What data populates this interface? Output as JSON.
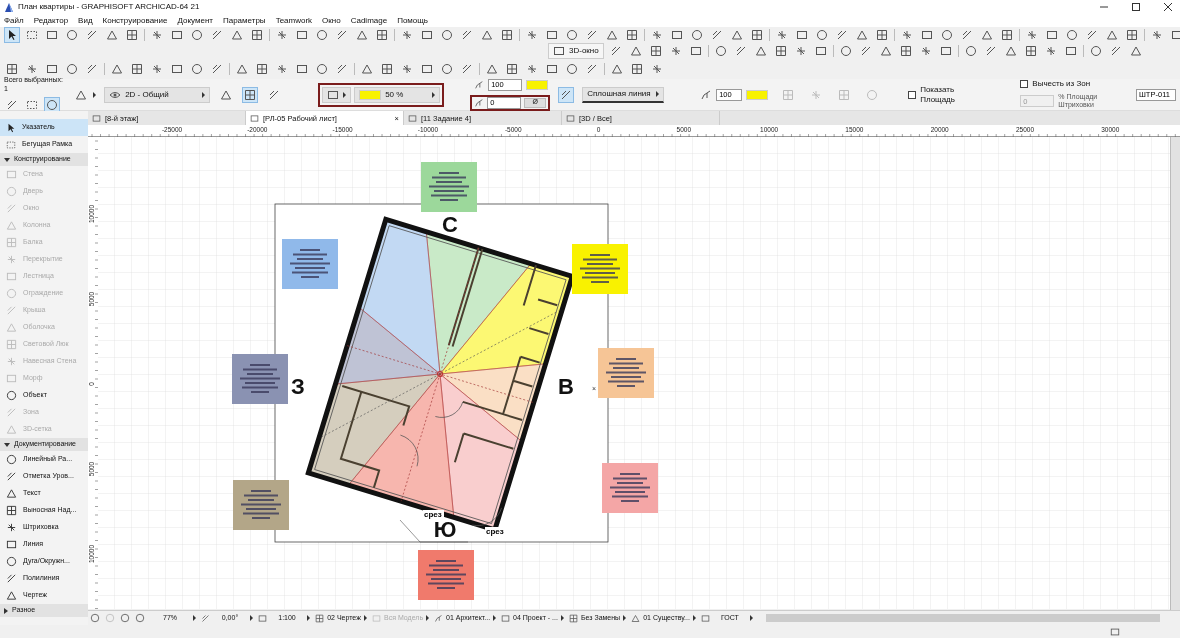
{
  "window": {
    "title": "План квартиры - GRAPHISOFT ARCHICAD-64 21"
  },
  "menu": [
    "Файл",
    "Редактор",
    "Вид",
    "Конструирование",
    "Документ",
    "Параметры",
    "Teamwork",
    "Окно",
    "Cadimage",
    "Помощь"
  ],
  "toolbar": {
    "view_3d_button": "3D-окно"
  },
  "info_box": {
    "selection_count": "Всего выбранных: 1",
    "layer_combo": "2D - Общий",
    "fill_reading": "50 %",
    "pen_weight": "100",
    "background_pen": "0",
    "background_button": "Ø",
    "line_type": "Сплошная линия",
    "fill_pen": "100",
    "show_area": {
      "label": "Показать Площадь",
      "checked": false
    },
    "subtract_zones": {
      "label": "Вычесть из Зон",
      "checked": false
    },
    "area_percent": {
      "value": "0",
      "disabled": true
    },
    "area_percent_label": "% Площади Штриховки",
    "hatch_id": "ШТР-011"
  },
  "tabs": [
    {
      "label": "[8-й этаж]",
      "selected": false
    },
    {
      "label": "[РЛ-05 Рабочий лист]",
      "selected": true,
      "close": "×"
    },
    {
      "label": "[11 Задание 4]",
      "selected": false
    },
    {
      "label": "[3D / Все]",
      "selected": false
    }
  ],
  "rulers": {
    "horizontal": [
      "-25000",
      "-20000",
      "-15000",
      "-10000",
      "-5000",
      "0",
      "5000",
      "10000",
      "15000",
      "20000",
      "25000",
      "30000"
    ],
    "vertical": [
      "10000",
      "5000",
      "0",
      "5000",
      "10000"
    ]
  },
  "sidebar": {
    "pointer_tools": [
      {
        "label": "Указатель",
        "selected": true
      },
      {
        "label": "Бегущая Рамка",
        "selected": false
      }
    ],
    "sections": [
      {
        "title": "Конструирование",
        "expanded": true,
        "items": [
          {
            "label": "Стена",
            "disabled": true
          },
          {
            "label": "Дверь",
            "disabled": true
          },
          {
            "label": "Окно",
            "disabled": true
          },
          {
            "label": "Колонна",
            "disabled": true
          },
          {
            "label": "Балка",
            "disabled": true
          },
          {
            "label": "Перекрытие",
            "disabled": true
          },
          {
            "label": "Лестница",
            "disabled": true
          },
          {
            "label": "Ограждение",
            "disabled": true
          },
          {
            "label": "Крыша",
            "disabled": true
          },
          {
            "label": "Оболочка",
            "disabled": true
          },
          {
            "label": "Световой Люк",
            "disabled": true
          },
          {
            "label": "Навесная Стена",
            "disabled": true
          },
          {
            "label": "Морф",
            "disabled": true
          },
          {
            "label": "Объект",
            "disabled": false
          },
          {
            "label": "Зона",
            "disabled": true
          },
          {
            "label": "3D-сетка",
            "disabled": true
          }
        ]
      },
      {
        "title": "Документирование",
        "expanded": true,
        "items": [
          {
            "label": "Линейный Ра...",
            "disabled": false
          },
          {
            "label": "Отметка Уров...",
            "disabled": false
          },
          {
            "label": "Текст",
            "disabled": false
          },
          {
            "label": "Выносная Над...",
            "disabled": false
          },
          {
            "label": "Штриховка",
            "disabled": false
          },
          {
            "label": "Линия",
            "disabled": false
          },
          {
            "label": "Дуга/Окружн...",
            "disabled": false
          },
          {
            "label": "Полилиния",
            "disabled": false
          },
          {
            "label": "Чертеж",
            "disabled": false
          }
        ]
      },
      {
        "title": "Разное",
        "expanded": false
      }
    ]
  },
  "plan": {
    "legend_cards": [
      {
        "color": "#9cd89b"
      },
      {
        "color": "#f9f200"
      },
      {
        "color": "#f6c596"
      },
      {
        "color": "#f4a6a6"
      },
      {
        "color": "#f07a6c"
      },
      {
        "color": "#b3a688"
      },
      {
        "color": "#8a92b2"
      },
      {
        "color": "#90b9ea"
      }
    ],
    "compass_labels": [
      "С",
      "В",
      "Ю",
      "З"
    ],
    "cut_labels": [
      "срез",
      "срез"
    ],
    "marker": "×"
  },
  "status_bar": [
    {
      "text": "77%",
      "disabled": false
    },
    {
      "text": "0,00°",
      "disabled": false
    },
    {
      "text": "1:100",
      "disabled": false
    },
    {
      "text": "02 Чертеж",
      "disabled": false
    },
    {
      "text": "Вся Модель",
      "disabled": true
    },
    {
      "text": "01 Архитект...",
      "disabled": false
    },
    {
      "text": "04 Проект - ...",
      "disabled": false
    },
    {
      "text": "Без Замены",
      "disabled": false
    },
    {
      "text": "01 Существу...",
      "disabled": false
    },
    {
      "text": "ГОСТ",
      "disabled": false
    }
  ]
}
